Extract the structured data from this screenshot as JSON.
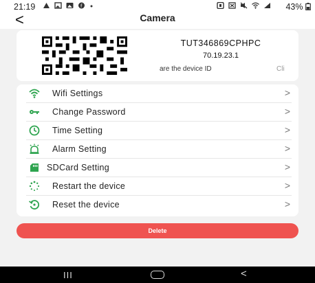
{
  "status_bar": {
    "time": "21:19",
    "battery": "43%",
    "left_icons": [
      "alert-icon",
      "image-icon",
      "gallery-icon",
      "facebook-icon",
      "dot-icon"
    ],
    "right_icons": [
      "nfc-icon",
      "cast-icon",
      "mute-icon",
      "wifi-icon",
      "signal-icon"
    ]
  },
  "header": {
    "back_label": "<",
    "title": "Camera"
  },
  "device": {
    "id": "TUT346869CPHPC",
    "version": "70.19.23.1",
    "share_text": "are the device ID",
    "clip_text": "Cli"
  },
  "menu": {
    "items": [
      {
        "label": "Wifi Settings",
        "icon": "wifi-icon"
      },
      {
        "label": "Change Password",
        "icon": "key-icon"
      },
      {
        "label": "Time Setting",
        "icon": "clock-icon"
      },
      {
        "label": "Alarm Setting",
        "icon": "alarm-icon"
      },
      {
        "label": "SDCard Setting",
        "icon": "sdcard-icon"
      },
      {
        "label": "Restart the device",
        "icon": "restart-icon"
      },
      {
        "label": "Reset the device",
        "icon": "reset-icon"
      }
    ],
    "chevron": ">"
  },
  "delete_label": "Delete",
  "colors": {
    "accent_green": "#2ea44f",
    "delete_red": "#ef5350"
  },
  "nav_bar": {
    "recents_label": "III",
    "back_label": "<"
  }
}
